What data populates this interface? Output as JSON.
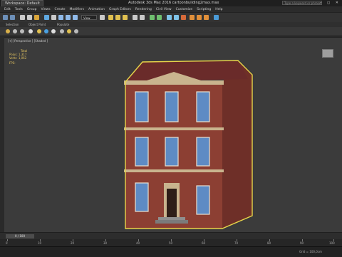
{
  "title_bar": {
    "workspace": "Workspace: Default",
    "app_title": "Autodesk 3ds Max 2016      cartoonbuilding2max.max",
    "search_placeholder": "Type a keyword or phrase",
    "window_controls": "– ◻ ✕"
  },
  "menu": [
    "Edit",
    "Tools",
    "Group",
    "Views",
    "Create",
    "Modifiers",
    "Animation",
    "Graph Editors",
    "Rendering",
    "Civil View",
    "Customize",
    "Scripting",
    "Help"
  ],
  "toolbar": {
    "view_dropdown": "View"
  },
  "ribbon_labels": {
    "selection": "Selection",
    "object_paint": "Object Paint",
    "populate": "Populate"
  },
  "viewport": {
    "label": "[+] [Perspective ] [Shaded ]",
    "stats": {
      "total": "Total",
      "polys_label": "Polys:",
      "polys_value": "1,317",
      "verts_label": "Verts:",
      "verts_value": "1,062",
      "fps": "FPS:"
    }
  },
  "timeline": {
    "frame": "0 / 100"
  },
  "ruler_ticks": [
    "0",
    "10",
    "20",
    "30",
    "40",
    "50",
    "60",
    "70",
    "80",
    "90",
    "100"
  ],
  "status": {
    "coords": "Grid = 100,0cm"
  },
  "colors": {
    "selection_outline": "#e6d44a",
    "brick": "#8c3f33",
    "trim": "#c9b48e",
    "window_glass": "#5e8bc4",
    "door": "#2e1e18"
  }
}
